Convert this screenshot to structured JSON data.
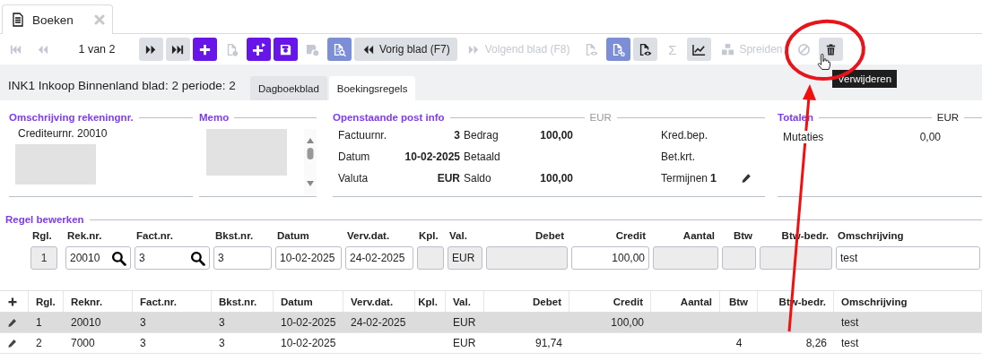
{
  "window": {
    "tab": {
      "title": "Boeken"
    }
  },
  "toolbar": [
    {
      "kind": "first",
      "disabled": true
    },
    {
      "kind": "prev",
      "disabled": true
    },
    {
      "kind": "pager",
      "label": "1 van 2"
    },
    {
      "kind": "next",
      "disabled": false
    },
    {
      "kind": "last",
      "disabled": false
    },
    {
      "kind": "add",
      "disabled": false
    },
    {
      "kind": "new-doc",
      "disabled": true
    },
    {
      "kind": "add-flag",
      "disabled": false
    },
    {
      "kind": "save",
      "disabled": false
    },
    {
      "kind": "save-off",
      "disabled": true
    },
    {
      "kind": "doc-search",
      "disabled": false
    },
    {
      "kind": "back-text",
      "disabled": false,
      "label": "Vorig blad (F7)"
    },
    {
      "kind": "forward-text",
      "disabled": true,
      "label": "Volgend blad (F8)"
    },
    {
      "kind": "doc-eye",
      "disabled": true
    },
    {
      "kind": "doc-link",
      "disabled": false
    },
    {
      "kind": "doc-eye",
      "disabled": false
    },
    {
      "kind": "sigma",
      "disabled": true,
      "label": "Σ"
    },
    {
      "kind": "chart",
      "disabled": false
    },
    {
      "kind": "cubes-text",
      "disabled": true,
      "label": "Spreiden"
    },
    {
      "kind": "block",
      "disabled": true
    },
    {
      "kind": "trash",
      "disabled": false
    }
  ],
  "tooltip": "Verwijderen",
  "header": {
    "title": "INK1 Inkoop Binnenland blad: 2 periode: 2"
  },
  "subtabs": [
    {
      "label": "Dagboekblad",
      "selected": false
    },
    {
      "label": "Boekingsregels",
      "selected": true
    }
  ],
  "account": {
    "heading": "Omschrijving rekeningnr.",
    "text": "Crediteurnr. 20010"
  },
  "memo": {
    "heading": "Memo"
  },
  "open_post": {
    "heading": "Openstaande post info",
    "currency": "EUR",
    "items": [
      {
        "label": "Factuurnr.",
        "value": "3"
      },
      {
        "label": "Bedrag",
        "value": "100,00"
      },
      {
        "label": "Datum",
        "value": "10-02-2025"
      },
      {
        "label": "Betaald"
      },
      {
        "label": "Valuta",
        "value": "EUR"
      },
      {
        "label": "Saldo",
        "value": "100,00"
      }
    ],
    "side": [
      {
        "label": "Kred.bep."
      },
      {
        "label": "Bet.krt."
      },
      {
        "label": "Termijnen",
        "value": "1",
        "editable": true
      }
    ]
  },
  "totals": {
    "heading": "Totalen",
    "currency": "EUR",
    "rows": [
      {
        "label": "Mutaties",
        "value": "0,00"
      }
    ]
  },
  "edit": {
    "heading": "Regel bewerken",
    "fields": [
      {
        "label": "Rgl.",
        "value": "1",
        "kind": "index",
        "disabled": true
      },
      {
        "label": "Rek.nr.",
        "value": "20010",
        "kind": "lookup",
        "disabled": false
      },
      {
        "label": "Fact.nr.",
        "value": "3",
        "kind": "lookup",
        "disabled": false
      },
      {
        "label": "Bkst.nr.",
        "value": "3",
        "kind": "text",
        "disabled": false
      },
      {
        "label": "Datum",
        "value": "10-02-2025",
        "kind": "text",
        "disabled": false
      },
      {
        "label": "Verv.dat.",
        "value": "24-02-2025",
        "kind": "text",
        "disabled": false
      },
      {
        "label": "Kpl.",
        "kind": "text",
        "disabled": true
      },
      {
        "label": "Val.",
        "value": "EUR",
        "kind": "text",
        "disabled": true
      },
      {
        "label": "Debet",
        "kind": "number",
        "disabled": true
      },
      {
        "label": "Credit",
        "value": "100,00",
        "kind": "number",
        "disabled": false
      },
      {
        "label": "Aantal",
        "kind": "number",
        "disabled": true
      },
      {
        "label": "Btw",
        "kind": "number",
        "disabled": true
      },
      {
        "label": "Btw-bedr.",
        "kind": "number",
        "disabled": true
      },
      {
        "label": "Omschrijving",
        "value": "test",
        "kind": "text",
        "disabled": false
      }
    ]
  },
  "table": {
    "columns": [
      {
        "label": "Rgl."
      },
      {
        "label": "Reknr."
      },
      {
        "label": "Fact.nr."
      },
      {
        "label": "Bkst.nr."
      },
      {
        "label": "Datum"
      },
      {
        "label": "Verv.dat."
      },
      {
        "label": "Kpl."
      },
      {
        "label": "Val."
      },
      {
        "label": "Debet"
      },
      {
        "label": "Credit"
      },
      {
        "label": "Aantal"
      },
      {
        "label": "Btw"
      },
      {
        "label": "Btw-bedr."
      },
      {
        "label": "Omschrijving"
      }
    ],
    "rows": [
      {
        "selected": true,
        "cells": [
          "1",
          "20010",
          "3",
          "3",
          "10-02-2025",
          "24-02-2025",
          null,
          "EUR",
          null,
          "100,00",
          null,
          null,
          null,
          "test"
        ]
      },
      {
        "selected": false,
        "cells": [
          "2",
          "7000",
          "3",
          "3",
          "10-02-2025",
          null,
          null,
          "EUR",
          "91,74",
          null,
          null,
          "4",
          "8,26",
          "test"
        ]
      }
    ]
  }
}
